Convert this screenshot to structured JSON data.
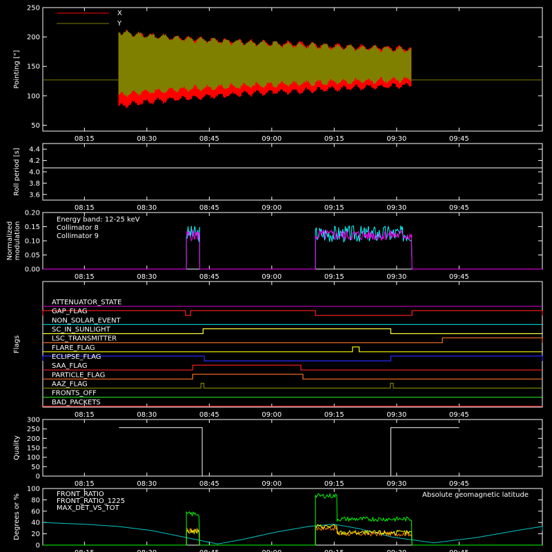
{
  "time_ticks": [
    "08:15",
    "08:30",
    "08:45",
    "09:00",
    "09:15",
    "09:30",
    "09:45"
  ],
  "colors": {
    "background": "#000000",
    "axes": "#ffffff",
    "x_series": "#ff0000",
    "y_series": "#808000",
    "coll8": "#00ffff",
    "coll9": "#ff00ff",
    "front_ratio": "#ffff00",
    "front_ratio_1225": "#00ff00",
    "max_det": "#ff8000",
    "geomag": "#00c8c8"
  },
  "chart_data": [
    {
      "id": "pointing",
      "type": "line",
      "ylabel": "Pointing [\"]",
      "ylim": [
        40,
        250
      ],
      "yticks": [
        "50",
        "100",
        "150",
        "200",
        "250"
      ],
      "legend": [
        "X",
        "Y"
      ],
      "legend_position": "top-left",
      "x_range_minutes": [
        8.3,
        13.5,
        73.6,
        78.5
      ],
      "series": [
        {
          "name": "X",
          "baseline": 127,
          "envelope_start": [
            80,
            210
          ],
          "envelope_end": [
            118,
            180
          ]
        },
        {
          "name": "Y",
          "baseline": 127,
          "envelope_start": [
            100,
            210
          ],
          "envelope_end": [
            128,
            178
          ]
        }
      ]
    },
    {
      "id": "roll",
      "type": "line",
      "ylabel": "Roll period [s]",
      "ylim": [
        3.5,
        4.5
      ],
      "yticks": [
        "3.6",
        "3.8",
        "4.0",
        "4.2",
        "4.4"
      ],
      "series": [
        {
          "name": "Roll period",
          "value": 4.07
        }
      ]
    },
    {
      "id": "modulation",
      "type": "line",
      "ylabel": "Normalized modulation",
      "ylim": [
        0,
        0.2
      ],
      "yticks": [
        "0.00",
        "0.05",
        "0.10",
        "0.15",
        "0.20"
      ],
      "annotations": [
        "Energy band: 12-25 keV"
      ],
      "legend": [
        "Collimator 8",
        "Collimator 9"
      ],
      "legend_position": "top-left",
      "segments_minutes": [
        [
          24.5,
          27.7
        ],
        [
          55.5,
          78.7
        ]
      ],
      "series": [
        {
          "name": "Collimator 8",
          "mean": 0.125,
          "spread": 0.03
        },
        {
          "name": "Collimator 9",
          "mean": 0.12,
          "spread": 0.02
        }
      ]
    },
    {
      "id": "flags",
      "type": "line",
      "ylabel": "Flags",
      "series": [
        {
          "name": "ATTENUATOR_STATE",
          "color": "#b000b0",
          "high": [],
          "level": "low"
        },
        {
          "name": "GAP_FLAG",
          "color": "#ff2020",
          "high": [
            [
              -10,
              24.3
            ],
            [
              25.5,
              55.5
            ],
            [
              78.7,
              140
            ]
          ]
        },
        {
          "name": "NON_SOLAR_EVENT",
          "color": "#00d8d8",
          "high": [],
          "level": "low"
        },
        {
          "name": "SC_IN_SUNLIGHT",
          "color": "#ffff40",
          "high": [
            [
              28.5,
              73.6
            ]
          ]
        },
        {
          "name": "LSC_TRANSMITTER",
          "color": "#ff7020",
          "high": [
            [
              86.0,
              140
            ]
          ]
        },
        {
          "name": "FLARE_FLAG",
          "color": "#ffff00",
          "high": [
            [
              64.4,
              66.0
            ]
          ]
        },
        {
          "name": "ECLIPSE_FLAG",
          "color": "#2828ff",
          "high": [
            [
              -10,
              28.8
            ],
            [
              73.6,
              140
            ]
          ]
        },
        {
          "name": "SAA_FLAG",
          "color": "#ff2020",
          "high": [
            [
              26.0,
              52.0
            ]
          ]
        },
        {
          "name": "PARTICLE_FLAG",
          "color": "#ff7020",
          "high": [
            [
              26.0,
              52.5
            ]
          ]
        },
        {
          "name": "AAZ_FLAG",
          "color": "#808000",
          "high": [
            [
              28.0,
              28.7
            ],
            [
              73.5,
              74.2
            ]
          ]
        },
        {
          "name": "FRONTS_OFF",
          "color": "#20e020",
          "high": [],
          "level": "low"
        },
        {
          "name": "BAD_PACKETS",
          "color": "#ff2020",
          "high": [],
          "level": "low"
        }
      ]
    },
    {
      "id": "quality",
      "type": "line",
      "ylabel": "Quality",
      "ylim": [
        0,
        300
      ],
      "yticks": [
        "0",
        "50",
        "100",
        "150",
        "200",
        "250",
        "300"
      ],
      "series": [
        {
          "name": "Quality",
          "segments": [
            [
              8.3,
              28.3,
              257
            ],
            [
              28.3,
              73.6,
              0
            ],
            [
              73.6,
              90.0,
              257
            ]
          ]
        }
      ]
    },
    {
      "id": "front_ratio",
      "type": "line",
      "ylabel": "Degrees or %",
      "ylim": [
        0,
        100
      ],
      "yticks": [
        "0",
        "20",
        "40",
        "60",
        "80",
        "100"
      ],
      "legend": [
        "FRONT_RATIO",
        "FRONT_RATIO_1225",
        "MAX_DET_VS_TOT"
      ],
      "legend_position": "top-left",
      "annotations": [
        "Absolute geomagnetic latitude"
      ],
      "series": [
        {
          "name": "FRONT_RATIO",
          "segments": [
            [
              24.5,
              27.7,
              24
            ],
            [
              55.5,
              60.7,
              33
            ],
            [
              60.7,
              78.7,
              22
            ]
          ]
        },
        {
          "name": "FRONT_RATIO_1225",
          "segments": [
            [
              24.5,
              27.7,
              55
            ],
            [
              55.5,
              60.7,
              87
            ],
            [
              60.7,
              78.7,
              46
            ]
          ]
        },
        {
          "name": "MAX_DET_VS_TOT",
          "segments": [
            [
              24.5,
              27.7,
              26
            ],
            [
              55.5,
              60.7,
              30
            ],
            [
              60.7,
              78.7,
              20
            ]
          ]
        },
        {
          "name": "Absolute geomagnetic latitude",
          "x": [
            -10,
            0,
            8,
            16,
            24,
            32,
            38,
            46,
            54,
            60,
            66,
            74,
            84,
            94,
            104,
            114,
            124,
            134
          ],
          "y": [
            40,
            37,
            33,
            26,
            14,
            2,
            10,
            23,
            33,
            37,
            29,
            14,
            4,
            13,
            26,
            33,
            34,
            25
          ]
        }
      ]
    }
  ]
}
